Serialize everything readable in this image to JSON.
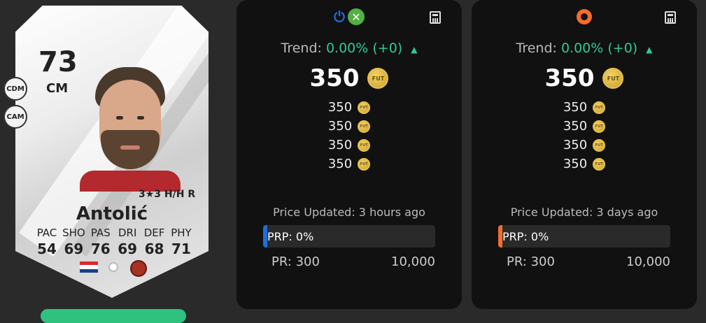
{
  "card": {
    "rating": "73",
    "position": "CM",
    "alt_positions": [
      "CDM",
      "CAM"
    ],
    "skills": "3★3 H/H R",
    "name": "Antolić",
    "stat_labels": [
      "PAC",
      "SHO",
      "PAS",
      "DRI",
      "DEF",
      "PHY"
    ],
    "stat_values": [
      "54",
      "69",
      "76",
      "69",
      "68",
      "71"
    ]
  },
  "panels": [
    {
      "platforms": [
        "playstation-icon",
        "xbox-icon"
      ],
      "trend_label": "Trend:",
      "trend_value": "0.00% (+0)",
      "price": "350",
      "coin_label": "FUT",
      "price_list": [
        "350",
        "350",
        "350",
        "350"
      ],
      "updated": "Price Updated: 3 hours ago",
      "prp": "PRP: 0%",
      "prp_color": "#1e6fd9",
      "pr_min": "PR: 300",
      "pr_max": "10,000"
    },
    {
      "platforms": [
        "origin-icon"
      ],
      "trend_label": "Trend:",
      "trend_value": "0.00% (+0)",
      "price": "350",
      "coin_label": "FUT",
      "price_list": [
        "350",
        "350",
        "350",
        "350"
      ],
      "updated": "Price Updated: 3 days ago",
      "prp": "PRP: 0%",
      "prp_color": "#f56c2d",
      "pr_min": "PR: 300",
      "pr_max": "10,000"
    }
  ],
  "colors": {
    "trend": "#2ecc8f",
    "coin": "#e8c14c",
    "panel_bg": "#111111"
  }
}
